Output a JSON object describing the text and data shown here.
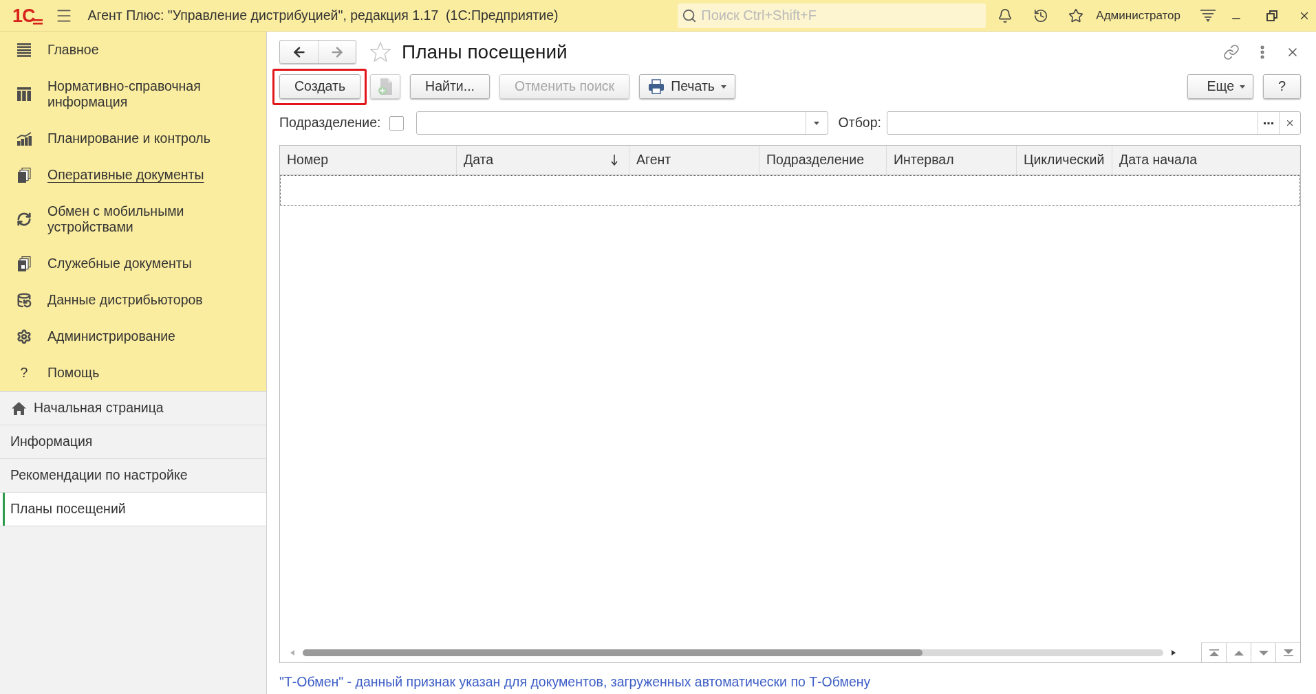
{
  "title_bar": {
    "logo": "1С",
    "title": "Агент Плюс: \"Управление дистрибуцией\", редакция 1.17  (1С:Предприятие)",
    "search": {
      "placeholder": "Поиск Ctrl+Shift+F"
    },
    "user": "Администратор"
  },
  "sections": [
    {
      "label": "Главное",
      "hovered": false
    },
    {
      "label": "Нормативно-справочная информация",
      "hovered": false
    },
    {
      "label": "Планирование и контроль",
      "hovered": false
    },
    {
      "label": "Оперативные документы",
      "hovered": true
    },
    {
      "label": "Обмен с мобильными устройствами",
      "hovered": false
    },
    {
      "label": "Служебные документы",
      "hovered": false
    },
    {
      "label": "Данные дистрибьюторов",
      "hovered": false
    },
    {
      "label": "Администрирование",
      "hovered": false
    },
    {
      "label": "Помощь",
      "hovered": false,
      "glyph": "?"
    }
  ],
  "open_pages": [
    {
      "kind": "home",
      "label": "Начальная страница",
      "selected": false
    },
    {
      "kind": "page",
      "label": "Информация",
      "selected": false
    },
    {
      "kind": "page",
      "label": "Рекомендации по настройке",
      "selected": false
    },
    {
      "kind": "page",
      "label": "Планы посещений",
      "selected": true
    }
  ],
  "form": {
    "navigation": [
      {
        "kind": "back",
        "disabled": false
      },
      {
        "kind": "forward",
        "disabled": true
      }
    ],
    "favorite": false,
    "title": "Планы посещений",
    "toolbar": [
      {
        "kind": "text",
        "label": "Создать",
        "disabled": false,
        "highlighted": true
      },
      {
        "kind": "icon",
        "disabled": true,
        "highlighted": false
      },
      {
        "kind": "text",
        "label": "Найти...",
        "disabled": false,
        "highlighted": false
      },
      {
        "kind": "text",
        "label": "Отменить поиск",
        "disabled": true,
        "highlighted": false
      },
      {
        "kind": "print",
        "label": "Печать",
        "disabled": false,
        "highlighted": false
      }
    ],
    "toolbar_right": [
      {
        "kind": "menu",
        "label": "Еще"
      },
      {
        "kind": "text",
        "label": "?"
      }
    ],
    "filters": {
      "subdivision": {
        "label": "Подразделение:",
        "checked": false
      },
      "selection": {
        "label": "Отбор:"
      }
    },
    "table": {
      "columns": [
        {
          "label": "Номер"
        },
        {
          "label": "Дата",
          "sort_descending": true
        },
        {
          "label": "Агент"
        },
        {
          "label": "Подразделение"
        },
        {
          "label": "Интервал"
        },
        {
          "label": "Циклический"
        },
        {
          "label": "Дата начала"
        }
      ]
    },
    "note": "\"Т-Обмен\" - данный признак указан для документов, загруженных автоматически по Т-Обмену"
  }
}
